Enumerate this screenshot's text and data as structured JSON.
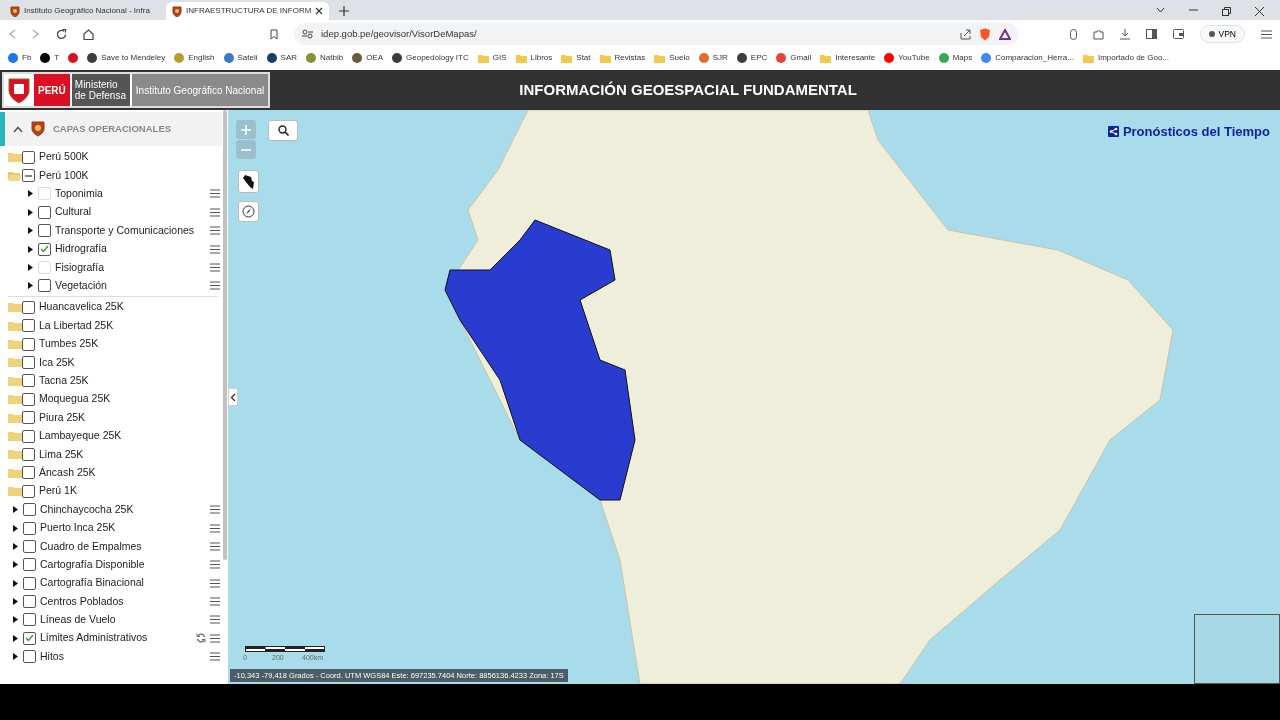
{
  "browser": {
    "tabs": [
      {
        "title": "Instituto Geográfico Nacional - Infra",
        "selected": false
      },
      {
        "title": "INFRAESTRUCTURA DE INFORM",
        "selected": true
      }
    ],
    "url": "idep.gob.pe/geovisor/VisorDeMapas/",
    "vpn": "VPN",
    "bookmarks": [
      {
        "kind": "site",
        "label": "Fb",
        "color": "#1877f2"
      },
      {
        "kind": "site",
        "label": "T",
        "color": "#000000"
      },
      {
        "kind": "site",
        "color": "#d91023"
      },
      {
        "kind": "site",
        "label": "Save to Mendeley",
        "color": "#3c3c3c"
      },
      {
        "kind": "site",
        "label": "English",
        "color": "#b89b2a"
      },
      {
        "kind": "site",
        "label": "Sateli",
        "color": "#3a78c9"
      },
      {
        "kind": "site",
        "label": "SAR",
        "color": "#1d3b6e"
      },
      {
        "kind": "site",
        "label": "Natbib",
        "color": "#8a8f3c"
      },
      {
        "kind": "site",
        "label": "OEA",
        "color": "#6b5a3a"
      },
      {
        "kind": "site",
        "label": "Geopedology ITC",
        "color": "#3c3c3c"
      },
      {
        "kind": "folder",
        "label": "GIS"
      },
      {
        "kind": "folder",
        "label": "Libros"
      },
      {
        "kind": "folder",
        "label": "Stat"
      },
      {
        "kind": "folder",
        "label": "Revistas"
      },
      {
        "kind": "folder",
        "label": "Suelo"
      },
      {
        "kind": "site",
        "label": "SJR",
        "color": "#e8692c"
      },
      {
        "kind": "site",
        "label": "EPC",
        "color": "#3c3c3c"
      },
      {
        "kind": "site",
        "label": "Gmail",
        "color": "#ea4335"
      },
      {
        "kind": "folder",
        "label": "Interesante"
      },
      {
        "kind": "site",
        "label": "YouTube",
        "color": "#ff0000"
      },
      {
        "kind": "site",
        "label": "Maps",
        "color": "#34a853"
      },
      {
        "kind": "site",
        "label": "Comparacion_Herra...",
        "color": "#4285f4"
      },
      {
        "kind": "folder",
        "label": "Importado de Goo..."
      }
    ]
  },
  "header": {
    "country": "PERÚ",
    "ministry": "Ministerio de Defensa",
    "institute": "Instituto Geográfico Nacional",
    "title": "INFORMACIÓN GEOESPACIAL FUNDAMENTAL"
  },
  "sidebar": {
    "title": "CAPAS OPERACIONALES",
    "layers": [
      {
        "kind": "folder",
        "label": "Perú 500K",
        "checked": false,
        "indeterminate": false,
        "disabled": false,
        "expanded": false,
        "loading": false
      },
      {
        "kind": "folder",
        "label": "Perú 100K",
        "checked": false,
        "indeterminate": true,
        "disabled": false,
        "expanded": true,
        "loading": false,
        "children": [
          {
            "kind": "layer",
            "label": "Toponimia",
            "checked": false,
            "indeterminate": false,
            "disabled": true,
            "expanded": false,
            "loading": false
          },
          {
            "kind": "layer",
            "label": "Cultural",
            "checked": false,
            "indeterminate": false,
            "disabled": false,
            "expanded": false,
            "loading": false
          },
          {
            "kind": "layer",
            "label": "Transporte y Comunicaciones",
            "checked": false,
            "indeterminate": false,
            "disabled": false,
            "expanded": false,
            "loading": false
          },
          {
            "kind": "layer",
            "label": "Hidrografía",
            "checked": true,
            "indeterminate": false,
            "disabled": false,
            "expanded": false,
            "loading": false
          },
          {
            "kind": "layer",
            "label": "Fisiografía",
            "checked": false,
            "indeterminate": false,
            "disabled": true,
            "expanded": false,
            "loading": false
          },
          {
            "kind": "layer",
            "label": "Vegetación",
            "checked": false,
            "indeterminate": false,
            "disabled": false,
            "expanded": false,
            "loading": false
          }
        ]
      },
      {
        "kind": "folder",
        "label": "Huancavelica 25K",
        "checked": false,
        "indeterminate": false,
        "disabled": false,
        "expanded": false,
        "loading": false
      },
      {
        "kind": "folder",
        "label": "La Libertad 25K",
        "checked": false,
        "indeterminate": false,
        "disabled": false,
        "expanded": false,
        "loading": false
      },
      {
        "kind": "folder",
        "label": "Tumbes 25K",
        "checked": false,
        "indeterminate": false,
        "disabled": false,
        "expanded": false,
        "loading": false
      },
      {
        "kind": "folder",
        "label": "Ica 25K",
        "checked": false,
        "indeterminate": false,
        "disabled": false,
        "expanded": false,
        "loading": false
      },
      {
        "kind": "folder",
        "label": "Tacna 25K",
        "checked": false,
        "indeterminate": false,
        "disabled": false,
        "expanded": false,
        "loading": false
      },
      {
        "kind": "folder",
        "label": "Moquegua 25K",
        "checked": false,
        "indeterminate": false,
        "disabled": false,
        "expanded": false,
        "loading": false
      },
      {
        "kind": "folder",
        "label": "Piura 25K",
        "checked": false,
        "indeterminate": false,
        "disabled": false,
        "expanded": false,
        "loading": false
      },
      {
        "kind": "folder",
        "label": "Lambayeque 25K",
        "checked": false,
        "indeterminate": false,
        "disabled": false,
        "expanded": false,
        "loading": false
      },
      {
        "kind": "folder",
        "label": "Lima 25K",
        "checked": false,
        "indeterminate": false,
        "disabled": false,
        "expanded": false,
        "loading": false
      },
      {
        "kind": "folder",
        "label": "Áncash 25K",
        "checked": false,
        "indeterminate": false,
        "disabled": false,
        "expanded": false,
        "loading": false
      },
      {
        "kind": "folder",
        "label": "Perú 1K",
        "checked": false,
        "indeterminate": false,
        "disabled": false,
        "expanded": false,
        "loading": false
      },
      {
        "kind": "layer",
        "label": "Chinchaycocha 25K",
        "checked": false,
        "indeterminate": false,
        "disabled": false,
        "expanded": false,
        "loading": false
      },
      {
        "kind": "layer",
        "label": "Puerto Inca 25K",
        "checked": false,
        "indeterminate": false,
        "disabled": false,
        "expanded": false,
        "loading": false
      },
      {
        "kind": "layer",
        "label": "Cuadro de Empalmes",
        "checked": false,
        "indeterminate": false,
        "disabled": false,
        "expanded": false,
        "loading": false
      },
      {
        "kind": "layer",
        "label": "Cartografía Disponible",
        "checked": false,
        "indeterminate": false,
        "disabled": false,
        "expanded": false,
        "loading": false
      },
      {
        "kind": "layer",
        "label": "Cartografía Binacional",
        "checked": false,
        "indeterminate": false,
        "disabled": false,
        "expanded": false,
        "loading": false
      },
      {
        "kind": "layer",
        "label": "Centros Poblados",
        "checked": false,
        "indeterminate": false,
        "disabled": false,
        "expanded": false,
        "loading": false
      },
      {
        "kind": "layer",
        "label": "Líneas de Vuelo",
        "checked": false,
        "indeterminate": false,
        "disabled": false,
        "expanded": false,
        "loading": false
      },
      {
        "kind": "layer",
        "label": "Límites Administrativos",
        "checked": true,
        "indeterminate": false,
        "disabled": false,
        "expanded": false,
        "loading": true
      },
      {
        "kind": "layer",
        "label": "Hitos",
        "checked": false,
        "indeterminate": false,
        "disabled": false,
        "expanded": false,
        "loading": false
      }
    ]
  },
  "map": {
    "link": "Pronósticos del Tiempo",
    "scale_labels": [
      "0",
      "200",
      "400km"
    ],
    "coordinates": "-10,343 -79,418 Grados - Coord. UTM WGS84 Este: 697235.7404 Norte: 8856136.4233 Zona: 17S"
  }
}
